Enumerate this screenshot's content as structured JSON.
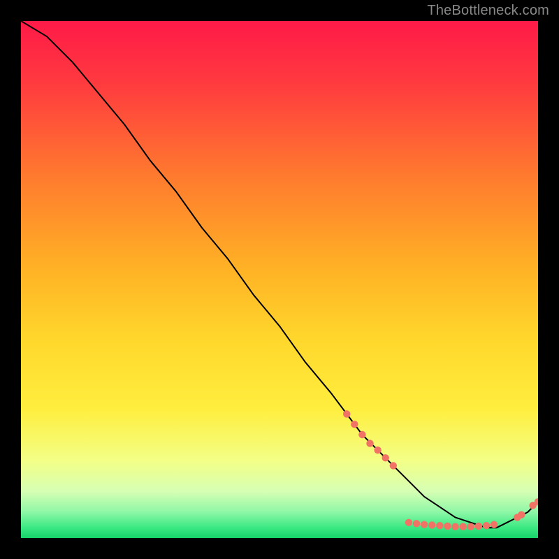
{
  "watermark": "TheBottleneck.com",
  "colors": {
    "page_bg": "#000000",
    "curve": "#000000",
    "marker_fill": "#f07366",
    "marker_stroke": "#f07366",
    "gradient_top": "#ff1a48",
    "gradient_yellow": "#ffe436",
    "gradient_pale": "#f4ffb8",
    "gradient_green_light": "#7cf59a",
    "gradient_green": "#1cdb6e"
  },
  "chart_data": {
    "type": "line",
    "title": "",
    "xlabel": "",
    "ylabel": "",
    "xlim": [
      0,
      100
    ],
    "ylim": [
      0,
      100
    ],
    "grid": false,
    "legend": false,
    "series": [
      {
        "name": "bottleneck-curve",
        "x": [
          0,
          5,
          10,
          15,
          20,
          25,
          30,
          35,
          40,
          45,
          50,
          55,
          60,
          63,
          66,
          69,
          72,
          75,
          78,
          81,
          84,
          87,
          90,
          92,
          94,
          96,
          98,
          100
        ],
        "y": [
          100,
          97,
          92,
          86,
          80,
          73,
          67,
          60,
          54,
          47,
          41,
          34,
          28,
          24,
          20,
          17,
          14,
          11,
          8,
          6,
          4,
          3,
          2,
          2,
          3,
          4,
          5,
          7
        ]
      }
    ],
    "markers": [
      {
        "x": 63,
        "y": 24
      },
      {
        "x": 64.5,
        "y": 22
      },
      {
        "x": 66,
        "y": 20
      },
      {
        "x": 67.5,
        "y": 18.3
      },
      {
        "x": 69,
        "y": 17
      },
      {
        "x": 70.5,
        "y": 15.5
      },
      {
        "x": 72,
        "y": 14
      },
      {
        "x": 75,
        "y": 3
      },
      {
        "x": 76.5,
        "y": 2.8
      },
      {
        "x": 78,
        "y": 2.6
      },
      {
        "x": 79.5,
        "y": 2.5
      },
      {
        "x": 81,
        "y": 2.4
      },
      {
        "x": 82.5,
        "y": 2.3
      },
      {
        "x": 84,
        "y": 2.2
      },
      {
        "x": 85.5,
        "y": 2.2
      },
      {
        "x": 87,
        "y": 2.2
      },
      {
        "x": 88.5,
        "y": 2.3
      },
      {
        "x": 90,
        "y": 2.4
      },
      {
        "x": 91.5,
        "y": 2.6
      },
      {
        "x": 96,
        "y": 4
      },
      {
        "x": 96.8,
        "y": 4.5
      },
      {
        "x": 99,
        "y": 6.3
      },
      {
        "x": 100,
        "y": 7
      }
    ]
  }
}
